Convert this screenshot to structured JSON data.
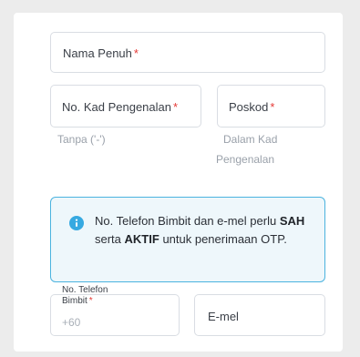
{
  "form": {
    "full_name": {
      "label": "Nama Penuh",
      "required_mark": "*"
    },
    "ic_number": {
      "label": "No. Kad Pengenalan",
      "required_mark": "*",
      "helper": "Tanpa ('-')"
    },
    "postcode": {
      "label": "Poskod",
      "required_mark": "*",
      "helper_line1": "Dalam Kad",
      "helper_line2": "Pengenalan"
    },
    "notice": {
      "part1": "No. Telefon Bimbit dan e-mel perlu",
      "bold1": "SAH",
      "part2": "serta",
      "bold2": "AKTIF",
      "part3": "untuk penerimaan",
      "part4": "OTP."
    },
    "phone": {
      "label_line1": "No. Telefon",
      "label_line2": "Bimbit",
      "required_mark": "*",
      "prefix": "+60"
    },
    "email": {
      "label": "E-mel"
    }
  },
  "colors": {
    "info_border": "#4bb3df",
    "info_icon": "#36a9e1",
    "required": "#e53935"
  },
  "icons": {
    "notice": "info-circle-icon"
  }
}
